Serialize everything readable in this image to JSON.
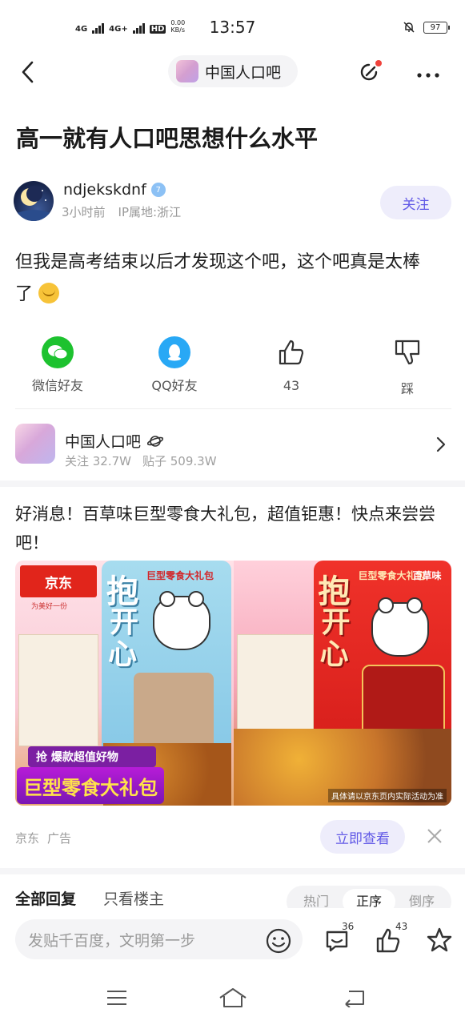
{
  "status_bar": {
    "network1": "4G",
    "network2": "4G+",
    "hd": "HD",
    "speed_top": "0.00",
    "speed_unit": "KB/s",
    "time": "13:57",
    "battery": "97"
  },
  "nav": {
    "forum_name": "中国人口吧"
  },
  "post": {
    "title": "高一就有人口吧思想什么水平",
    "author": {
      "name": "ndjekskdnf",
      "level": "7",
      "time": "3小时前",
      "ip": "IP属地:浙江",
      "follow_label": "关注"
    },
    "content_line1": "但我是高考结束以后才发现这个吧，这个吧真是太棒",
    "content_line2": "了"
  },
  "share": {
    "wechat": "微信好友",
    "qq": "QQ好友",
    "likes": "43",
    "dislike": "踩"
  },
  "forum_card": {
    "name": "中国人口吧",
    "followers": "关注 32.7W",
    "posts": "贴子 509.3W"
  },
  "ad": {
    "text": "好消息！百草味巨型零食大礼包，超值钜惠！快点来尝尝吧！",
    "jd_logo": "京东",
    "jd_slogan": "为美好一份",
    "bag_chars_left": [
      "抱",
      "开",
      "心"
    ],
    "bag_chars_right": [
      "抱",
      "开",
      "心"
    ],
    "bag_subtitle": "巨型零食大礼包",
    "brand": "百草味",
    "banner_small": "抢 爆款超值好物",
    "banner_big": "巨型零食大礼包",
    "disclaimer": "具体请以京东页内实际活动为准",
    "source": "京东",
    "ad_tag": "广告",
    "cta": "立即查看"
  },
  "replies": {
    "tab_all": "全部回复",
    "tab_op": "只看楼主",
    "sort": [
      "热门",
      "正序",
      "倒序"
    ],
    "sort_active": "正序"
  },
  "input_bar": {
    "placeholder": "发贴千百度，文明第一步",
    "comment_count": "36",
    "like_count": "43"
  },
  "colors": {
    "accent": "#6159e6",
    "accent_bg": "#eeedfb",
    "wechat": "#1dc22f",
    "qq": "#28a8f5"
  }
}
